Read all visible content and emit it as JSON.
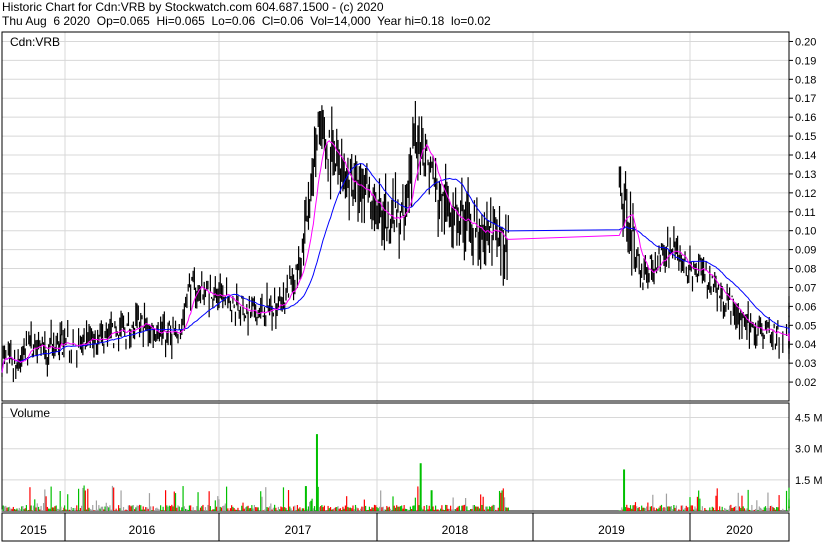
{
  "header": {
    "line1": "Historic Chart for Cdn:VRB by Stockwatch.com 604.687.1500 - (c) 2020",
    "line2": "Thu Aug  6 2020  Op=0.065  Hi=0.065  Lo=0.06  Cl=0.06  Vol=14,000  Year hi=0.18  lo=0.02"
  },
  "chart_data": [
    {
      "type": "line",
      "title": "Cdn:VRB",
      "ylim": [
        0.01,
        0.205
      ],
      "y_ticks": [
        "0.02",
        "0.03",
        "0.04",
        "0.05",
        "0.06",
        "0.07",
        "0.08",
        "0.09",
        "0.10",
        "0.11",
        "0.12",
        "0.13",
        "0.14",
        "0.15",
        "0.16",
        "0.17",
        "0.18",
        "0.19",
        "0.20"
      ],
      "x_labels": [
        "2015",
        "2016",
        "2017",
        "2018",
        "2019",
        "2020"
      ],
      "grid": true,
      "price_path": [
        [
          2015.0,
          0.03
        ],
        [
          2015.12,
          0.03
        ],
        [
          2015.2,
          0.025
        ],
        [
          2015.35,
          0.035
        ],
        [
          2015.5,
          0.04
        ],
        [
          2015.7,
          0.035
        ],
        [
          2015.9,
          0.04
        ],
        [
          2016.1,
          0.04
        ],
        [
          2016.3,
          0.045
        ],
        [
          2016.5,
          0.05
        ],
        [
          2016.75,
          0.045
        ],
        [
          2016.8,
          0.07
        ],
        [
          2017.0,
          0.065
        ],
        [
          2017.2,
          0.055
        ],
        [
          2017.4,
          0.065
        ],
        [
          2017.52,
          0.08
        ],
        [
          2017.62,
          0.15
        ],
        [
          2017.8,
          0.13
        ],
        [
          2018.0,
          0.11
        ],
        [
          2018.15,
          0.105
        ],
        [
          2018.27,
          0.155
        ],
        [
          2018.4,
          0.115
        ],
        [
          2018.6,
          0.105
        ],
        [
          2018.85,
          0.09
        ],
        [
          2019.0,
          null
        ],
        [
          2019.55,
          0.12
        ],
        [
          2019.7,
          0.075
        ],
        [
          2019.85,
          0.09
        ],
        [
          2020.0,
          0.08
        ],
        [
          2020.2,
          0.075
        ],
        [
          2020.4,
          0.06
        ],
        [
          2020.6,
          0.05
        ],
        [
          2020.9,
          0.045
        ],
        [
          2021.2,
          0.045
        ],
        [
          2021.4,
          0.04
        ],
        [
          2021.55,
          0.045
        ],
        [
          2021.75,
          0.05
        ],
        [
          2021.9,
          0.065
        ],
        [
          2022.0,
          0.06
        ]
      ],
      "series": [
        {
          "color": "#000000",
          "values": "daily OHLC bars"
        },
        {
          "color": "#ff00ff",
          "values": "short moving average"
        },
        {
          "color": "#0000ff",
          "values": "long moving average"
        }
      ]
    },
    {
      "type": "bar",
      "title": "Volume",
      "ylim": [
        0,
        5200000
      ],
      "y_ticks": [
        "1.5 M",
        "3.0 M",
        "4.5 M"
      ],
      "spikes": [
        {
          "x": 2017.62,
          "value": 3700000
        },
        {
          "x": 2018.28,
          "value": 2300000
        },
        {
          "x": 2019.58,
          "value": 2000000
        },
        {
          "x": 2017.55,
          "value": 1200000
        },
        {
          "x": 2018.35,
          "value": 1000000
        }
      ],
      "colors": {
        "up": "#00c000",
        "down": "#ff0000",
        "flat": "#a0a0a0"
      }
    }
  ]
}
